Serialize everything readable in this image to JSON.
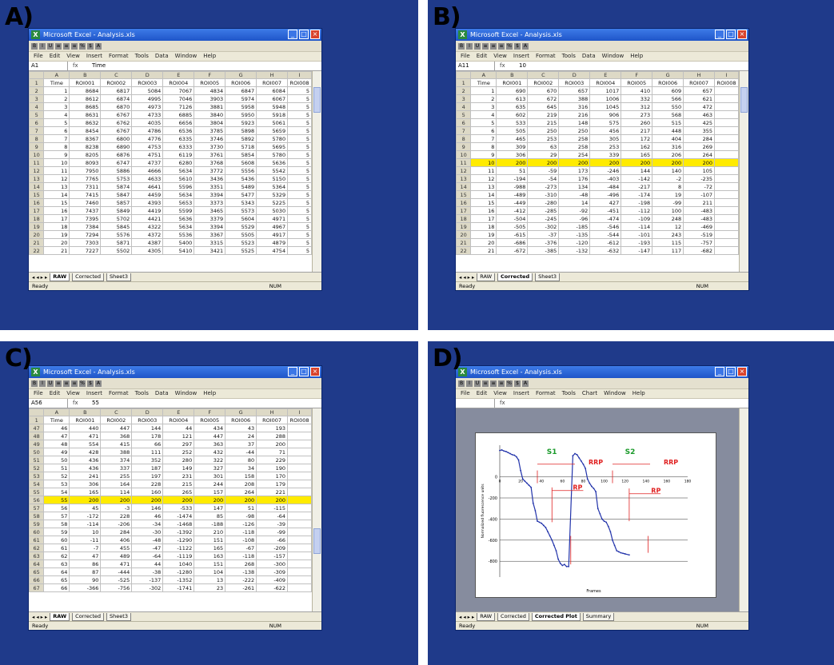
{
  "panels": [
    {
      "label": "A)",
      "title": "Microsoft Excel - Analysis.xls",
      "name_box": "A1",
      "formula": "Time",
      "active_tab": "RAW",
      "menu": [
        "File",
        "Edit",
        "View",
        "Insert",
        "Format",
        "Tools",
        "Data",
        "Window",
        "Help"
      ],
      "col_letters": [
        "",
        "A",
        "B",
        "C",
        "D",
        "E",
        "F",
        "G",
        "H",
        "I"
      ],
      "header_row": [
        "1",
        "Time",
        "ROI001",
        "ROI002",
        "ROI003",
        "ROI004",
        "ROI005",
        "ROI006",
        "ROI007",
        "ROI008"
      ],
      "rows": [
        [
          "2",
          "1",
          "8684",
          "6817",
          "5084",
          "7067",
          "4834",
          "6847",
          "6084",
          "5"
        ],
        [
          "3",
          "2",
          "8612",
          "6874",
          "4995",
          "7046",
          "3903",
          "5974",
          "6067",
          "5"
        ],
        [
          "4",
          "3",
          "8685",
          "6870",
          "4973",
          "7126",
          "3881",
          "5958",
          "5948",
          "5"
        ],
        [
          "5",
          "4",
          "8631",
          "6767",
          "4733",
          "6885",
          "3840",
          "5950",
          "5918",
          "5"
        ],
        [
          "6",
          "5",
          "8632",
          "6762",
          "4035",
          "6656",
          "3804",
          "5923",
          "5061",
          "5"
        ],
        [
          "7",
          "6",
          "8454",
          "6767",
          "4786",
          "6536",
          "3785",
          "5898",
          "5659",
          "5"
        ],
        [
          "8",
          "7",
          "8367",
          "6800",
          "4776",
          "6335",
          "3746",
          "5892",
          "5780",
          "5"
        ],
        [
          "9",
          "8",
          "8238",
          "6890",
          "4753",
          "6333",
          "3730",
          "5718",
          "5695",
          "5"
        ],
        [
          "10",
          "9",
          "8205",
          "6876",
          "4751",
          "6119",
          "3761",
          "5854",
          "5780",
          "5"
        ],
        [
          "11",
          "10",
          "8093",
          "6747",
          "4737",
          "6280",
          "3768",
          "5608",
          "5636",
          "5"
        ],
        [
          "12",
          "11",
          "7950",
          "5886",
          "4666",
          "5634",
          "3772",
          "5556",
          "5542",
          "5"
        ],
        [
          "13",
          "12",
          "7765",
          "5753",
          "4633",
          "5610",
          "3436",
          "5436",
          "5150",
          "5"
        ],
        [
          "14",
          "13",
          "7311",
          "5874",
          "4641",
          "5596",
          "3351",
          "5489",
          "5364",
          "5"
        ],
        [
          "15",
          "14",
          "7415",
          "5847",
          "4459",
          "5634",
          "3394",
          "5477",
          "5329",
          "5"
        ],
        [
          "16",
          "15",
          "7460",
          "5857",
          "4393",
          "5653",
          "3373",
          "5343",
          "5225",
          "5"
        ],
        [
          "17",
          "16",
          "7437",
          "5849",
          "4419",
          "5599",
          "3465",
          "5573",
          "5030",
          "5"
        ],
        [
          "18",
          "17",
          "7395",
          "5702",
          "4421",
          "5636",
          "3379",
          "5604",
          "4971",
          "5"
        ],
        [
          "19",
          "18",
          "7384",
          "5845",
          "4322",
          "5634",
          "3394",
          "5529",
          "4967",
          "5"
        ],
        [
          "20",
          "19",
          "7294",
          "5576",
          "4372",
          "5536",
          "3367",
          "5505",
          "4917",
          "5"
        ],
        [
          "21",
          "20",
          "7303",
          "5871",
          "4387",
          "5400",
          "3315",
          "5523",
          "4879",
          "5"
        ],
        [
          "22",
          "21",
          "7227",
          "5502",
          "4305",
          "5410",
          "3421",
          "5525",
          "4754",
          "5"
        ]
      ],
      "tabs": [
        "RAW",
        "Corrected",
        "Sheet3"
      ],
      "status": "Ready",
      "status_right": "NUM"
    },
    {
      "label": "B)",
      "title": "Microsoft Excel - Analysis.xls",
      "name_box": "A11",
      "formula": "10",
      "active_tab": "Corrected",
      "menu": [
        "File",
        "Edit",
        "View",
        "Insert",
        "Format",
        "Tools",
        "Data",
        "Window",
        "Help"
      ],
      "col_letters": [
        "",
        "A",
        "B",
        "C",
        "D",
        "E",
        "F",
        "G",
        "H",
        "I"
      ],
      "header_row": [
        "1",
        "Time",
        "ROI001",
        "ROI002",
        "ROI003",
        "ROI004",
        "ROI005",
        "ROI006",
        "ROI007",
        "ROI008"
      ],
      "rows": [
        [
          "2",
          "1",
          "690",
          "670",
          "657",
          "1017",
          "410",
          "609",
          "657",
          ""
        ],
        [
          "3",
          "2",
          "613",
          "672",
          "388",
          "1006",
          "332",
          "566",
          "621",
          ""
        ],
        [
          "4",
          "3",
          "635",
          "645",
          "316",
          "1045",
          "312",
          "550",
          "472",
          ""
        ],
        [
          "5",
          "4",
          "602",
          "219",
          "216",
          "906",
          "273",
          "568",
          "463",
          ""
        ],
        [
          "6",
          "5",
          "533",
          "215",
          "148",
          "575",
          "260",
          "515",
          "425",
          ""
        ],
        [
          "7",
          "6",
          "505",
          "250",
          "250",
          "456",
          "217",
          "448",
          "355",
          ""
        ],
        [
          "8",
          "7",
          "465",
          "253",
          "258",
          "305",
          "172",
          "404",
          "284",
          ""
        ],
        [
          "9",
          "8",
          "309",
          "63",
          "258",
          "253",
          "162",
          "316",
          "269",
          ""
        ],
        [
          "10",
          "9",
          "306",
          "29",
          "254",
          "339",
          "165",
          "206",
          "264",
          ""
        ],
        [
          "11",
          "10",
          "200",
          "200",
          "200",
          "200",
          "200",
          "200",
          "200",
          ""
        ],
        [
          "12",
          "11",
          "51",
          "-59",
          "173",
          "-246",
          "144",
          "140",
          "105",
          ""
        ],
        [
          "13",
          "12",
          "-194",
          "-54",
          "176",
          "-403",
          "-142",
          "-2",
          "-235",
          ""
        ],
        [
          "14",
          "13",
          "-988",
          "-273",
          "134",
          "-484",
          "-217",
          "8",
          "-72",
          ""
        ],
        [
          "15",
          "14",
          "-489",
          "-310",
          "-48",
          "-496",
          "-174",
          "19",
          "-107",
          ""
        ],
        [
          "16",
          "15",
          "-449",
          "-280",
          "14",
          "427",
          "-198",
          "-99",
          "211",
          ""
        ],
        [
          "17",
          "16",
          "-412",
          "-285",
          "-92",
          "-451",
          "-112",
          "100",
          "-483",
          ""
        ],
        [
          "18",
          "17",
          "-504",
          "-245",
          "-96",
          "-474",
          "-109",
          "248",
          "-483",
          ""
        ],
        [
          "19",
          "18",
          "-505",
          "-302",
          "-185",
          "-546",
          "-114",
          "12",
          "-469",
          ""
        ],
        [
          "20",
          "19",
          "-615",
          "-37",
          "-135",
          "-544",
          "-101",
          "243",
          "-519",
          ""
        ],
        [
          "21",
          "20",
          "-686",
          "-376",
          "-120",
          "-612",
          "-193",
          "115",
          "-757",
          ""
        ],
        [
          "22",
          "21",
          "-672",
          "-385",
          "-132",
          "-632",
          "-147",
          "117",
          "-682",
          ""
        ]
      ],
      "tabs": [
        "RAW",
        "Corrected",
        "Sheet3"
      ],
      "status": "Ready",
      "status_right": "NUM"
    },
    {
      "label": "C)",
      "title": "Microsoft Excel - Analysis.xls",
      "name_box": "A56",
      "formula": "55",
      "active_tab": "RAW",
      "menu": [
        "File",
        "Edit",
        "View",
        "Insert",
        "Format",
        "Tools",
        "Data",
        "Window",
        "Help"
      ],
      "col_letters": [
        "",
        "A",
        "B",
        "C",
        "D",
        "E",
        "F",
        "G",
        "H",
        "I"
      ],
      "header_row": [
        "1",
        "Time",
        "ROI001",
        "ROI002",
        "ROI003",
        "ROI004",
        "ROI005",
        "ROI006",
        "ROI007",
        "ROI008"
      ],
      "rows": [
        [
          "47",
          "46",
          "440",
          "447",
          "144",
          "44",
          "434",
          "43",
          "193",
          ""
        ],
        [
          "48",
          "47",
          "471",
          "368",
          "178",
          "121",
          "447",
          "24",
          "288",
          ""
        ],
        [
          "49",
          "48",
          "554",
          "415",
          "66",
          "297",
          "363",
          "37",
          "200",
          ""
        ],
        [
          "50",
          "49",
          "428",
          "388",
          "111",
          "252",
          "432",
          "-44",
          "71",
          ""
        ],
        [
          "51",
          "50",
          "436",
          "374",
          "352",
          "280",
          "322",
          "80",
          "229",
          ""
        ],
        [
          "52",
          "51",
          "436",
          "337",
          "187",
          "149",
          "327",
          "34",
          "190",
          ""
        ],
        [
          "53",
          "52",
          "241",
          "255",
          "197",
          "231",
          "301",
          "158",
          "170",
          ""
        ],
        [
          "54",
          "53",
          "306",
          "164",
          "228",
          "215",
          "244",
          "208",
          "179",
          ""
        ],
        [
          "55",
          "54",
          "165",
          "114",
          "160",
          "265",
          "157",
          "264",
          "221",
          ""
        ],
        [
          "56",
          "55",
          "200",
          "200",
          "200",
          "200",
          "200",
          "200",
          "200",
          ""
        ],
        [
          "57",
          "56",
          "45",
          "-3",
          "146",
          "-533",
          "147",
          "51",
          "-115",
          ""
        ],
        [
          "58",
          "57",
          "-172",
          "228",
          "46",
          "-1474",
          "85",
          "-98",
          "-64",
          ""
        ],
        [
          "59",
          "58",
          "-114",
          "-206",
          "-34",
          "-1468",
          "-188",
          "-126",
          "-39",
          ""
        ],
        [
          "60",
          "59",
          "10",
          "284",
          "-30",
          "-1392",
          "210",
          "-118",
          "-99",
          ""
        ],
        [
          "61",
          "60",
          "-11",
          "406",
          "-48",
          "-1290",
          "151",
          "-108",
          "-66",
          ""
        ],
        [
          "62",
          "61",
          "-7",
          "455",
          "-47",
          "-1122",
          "165",
          "-67",
          "-209",
          ""
        ],
        [
          "63",
          "62",
          "47",
          "489",
          "-64",
          "-1119",
          "163",
          "-118",
          "-157",
          ""
        ],
        [
          "64",
          "63",
          "86",
          "471",
          "44",
          "1040",
          "151",
          "268",
          "-300",
          ""
        ],
        [
          "65",
          "64",
          "87",
          "-444",
          "-38",
          "-1280",
          "104",
          "-138",
          "-309",
          ""
        ],
        [
          "66",
          "65",
          "90",
          "-525",
          "-137",
          "-1352",
          "13",
          "-222",
          "-409",
          ""
        ],
        [
          "67",
          "66",
          "-366",
          "-756",
          "-302",
          "-1741",
          "23",
          "-261",
          "-622",
          ""
        ]
      ],
      "tabs": [
        "RAW",
        "Corrected",
        "Sheet3"
      ],
      "status": "Ready",
      "status_right": "NUM"
    }
  ],
  "chart_panel": {
    "label": "D)",
    "title": "Microsoft Excel - Analysis.xls",
    "menu": [
      "File",
      "Edit",
      "View",
      "Insert",
      "Format",
      "Tools",
      "Chart",
      "Window",
      "Help"
    ],
    "tabs": [
      "RAW",
      "Corrected",
      "Corrected Plot",
      "Summary"
    ],
    "active_tab": "Corrected Plot",
    "status": "Ready",
    "status_right": "NUM"
  },
  "chart_data": {
    "type": "line",
    "xlabel": "Frames",
    "ylabel": "Normalized fluorescence units",
    "annotations": [
      {
        "text": "S1",
        "color": "#1a9a2a"
      },
      {
        "text": "S2",
        "color": "#1a9a2a"
      },
      {
        "text": "RRP",
        "color": "#e02020"
      },
      {
        "text": "RRP",
        "color": "#e02020"
      },
      {
        "text": "RP",
        "color": "#e02020"
      },
      {
        "text": "RP",
        "color": "#e02020"
      }
    ],
    "xticks": [
      "0",
      "20",
      "40",
      "60",
      "80",
      "100",
      "120",
      "140",
      "160",
      "180"
    ],
    "yticks": [
      "0",
      "-200",
      "-400",
      "-600",
      "-800"
    ],
    "x_range": [
      0,
      180
    ],
    "y_range": [
      -950,
      300
    ],
    "series": [
      {
        "color": "#2233aa",
        "x": [
          0,
          2,
          4,
          6,
          8,
          10,
          12,
          14,
          16,
          18,
          20,
          22,
          24,
          26,
          28,
          30,
          32,
          34,
          36,
          38,
          40,
          42,
          44,
          46,
          48,
          50,
          52,
          54,
          56,
          58,
          60,
          62,
          64,
          66,
          70,
          72,
          74,
          76,
          78,
          80,
          82,
          84,
          86,
          88,
          90,
          92,
          94,
          96,
          98,
          100,
          102,
          104,
          106,
          108,
          110,
          112,
          114,
          116,
          118,
          120,
          124
        ],
        "y": [
          250,
          255,
          245,
          240,
          230,
          220,
          210,
          205,
          190,
          160,
          60,
          -20,
          -40,
          -60,
          -80,
          -100,
          -250,
          -320,
          -420,
          -430,
          -440,
          -460,
          -480,
          -520,
          -560,
          -600,
          -650,
          -700,
          -780,
          -820,
          -840,
          -830,
          -850,
          -850,
          200,
          220,
          210,
          180,
          150,
          120,
          80,
          -20,
          -60,
          -90,
          -110,
          -140,
          -300,
          -350,
          -400,
          -420,
          -430,
          -470,
          -520,
          -600,
          -650,
          -700,
          -710,
          -720,
          -725,
          -730,
          -740
        ]
      }
    ]
  }
}
